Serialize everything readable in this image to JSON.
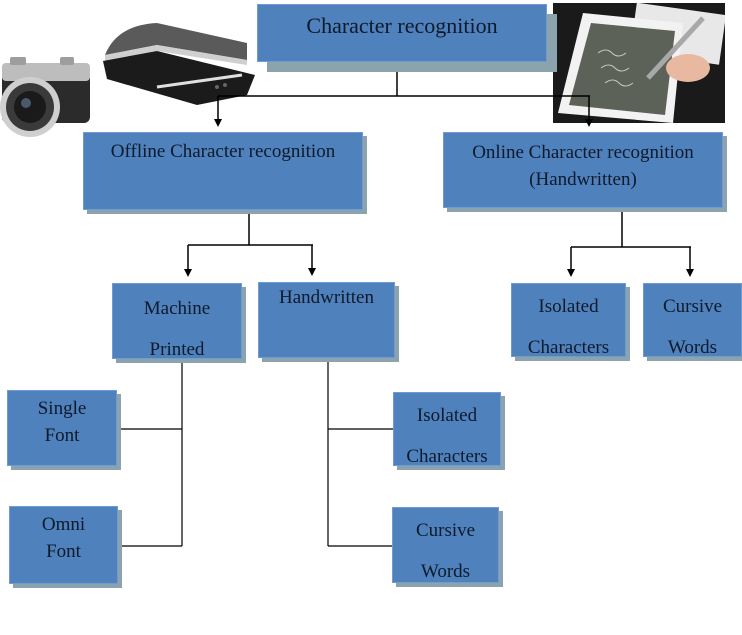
{
  "diagram": {
    "title": "Character recognition",
    "nodes": {
      "root": {
        "lines": [
          "Character recognition"
        ]
      },
      "offline": {
        "lines": [
          "Offline Character recognition"
        ]
      },
      "online": {
        "lines": [
          "Online Character recognition",
          "(Handwritten)"
        ]
      },
      "machine_printed": {
        "lines": [
          "Machine",
          "Printed"
        ]
      },
      "handwritten": {
        "lines": [
          "Handwritten"
        ]
      },
      "online_isolated": {
        "lines": [
          "Isolated",
          "Characters"
        ]
      },
      "online_cursive": {
        "lines": [
          "Cursive",
          "Words"
        ]
      },
      "single_font": {
        "lines": [
          "Single",
          "Font"
        ]
      },
      "omni_font": {
        "lines": [
          "Omni",
          "Font"
        ]
      },
      "hw_isolated": {
        "lines": [
          "Isolated",
          "Characters"
        ]
      },
      "hw_cursive": {
        "lines": [
          "Cursive",
          "Words"
        ]
      }
    },
    "edges": [
      [
        "root",
        "offline"
      ],
      [
        "root",
        "online"
      ],
      [
        "offline",
        "machine_printed"
      ],
      [
        "offline",
        "handwritten"
      ],
      [
        "online",
        "online_isolated"
      ],
      [
        "online",
        "online_cursive"
      ],
      [
        "machine_printed",
        "single_font"
      ],
      [
        "machine_printed",
        "omni_font"
      ],
      [
        "handwritten",
        "hw_isolated"
      ],
      [
        "handwritten",
        "hw_cursive"
      ]
    ],
    "images": {
      "camera": "camera-photo",
      "scanner": "flatbed-scanner-photo",
      "tablet": "handwriting-tablet-photo"
    },
    "colors": {
      "box_fill": "#4f81bd",
      "box_shadow": "#8aa3ac",
      "text": "#0e1a2b",
      "connector": "#000000"
    }
  }
}
